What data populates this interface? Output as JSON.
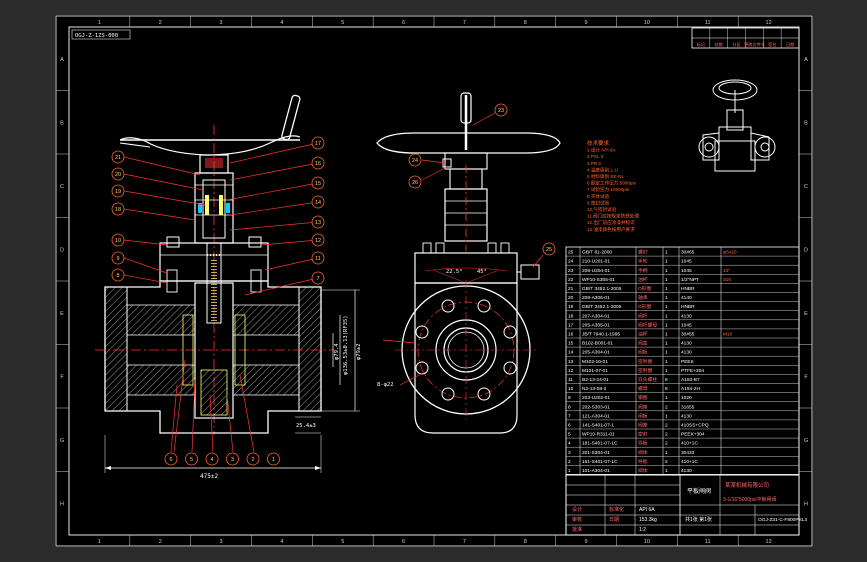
{
  "drawing_number_box": "OGJ-Z-1ZS-000",
  "frame": {
    "columns": [
      "1",
      "2",
      "3",
      "4",
      "5",
      "6",
      "7",
      "8",
      "9",
      "10",
      "11",
      "12"
    ],
    "rows": [
      "A",
      "B",
      "C",
      "D",
      "E",
      "F",
      "G",
      "H"
    ]
  },
  "dimensions": {
    "overall_length": "475±2",
    "bore": "φ79.4",
    "bolt_circle": "φ136.53±0.13(RF35)",
    "flange_od": "φ79±2",
    "raised_face": "25.4±3",
    "bolt_holes": "8-φ22",
    "angle_a": "22.5°",
    "angle_b": "45°",
    "extra": "25.5"
  },
  "left_balloons": [
    "21",
    "20",
    "19",
    "18",
    "10",
    "9",
    "8"
  ],
  "right_balloons": [
    "17",
    "16",
    "15",
    "14",
    "13",
    "12",
    "11",
    "7"
  ],
  "bottom_balloons": [
    "6",
    "5",
    "4",
    "3",
    "2",
    "1"
  ],
  "side_balloons": [
    "23",
    "24",
    "26",
    "25"
  ],
  "tech_notes": [
    "技术要求",
    "1.设计 API 6A",
    "2.PSL 3",
    "3.PR 2",
    "4.温度级别 L-U",
    "5.材料级别 EE-NL",
    "6.额定工作压力 5000psi",
    "7.试验压力 10000psi",
    "8.壳体试验",
    "9.密封试验",
    "10.气密封试验",
    "11.阀门应按规定防锈处理",
    "12.出厂前应涂漆并标识",
    "13.油漆颜色按用户要求"
  ],
  "bom": [
    {
      "no": "25",
      "code": "GB/T 81-2000",
      "name": "螺钉",
      "qty": "1",
      "mat": "30#65",
      "note": "φ5x10"
    },
    {
      "no": "24",
      "code": "210-U201-01",
      "name": "手轮",
      "qty": "1",
      "mat": "1045",
      "note": ""
    },
    {
      "no": "23",
      "code": "208-U204-01",
      "name": "手柄",
      "qty": "1",
      "mat": "1045",
      "note": "10\""
    },
    {
      "no": "22",
      "code": "WP10-S305-01",
      "name": "油杯",
      "qty": "1",
      "mat": "1/2\"NPT",
      "note": "316"
    },
    {
      "no": "21",
      "code": "GB/T 3452.1-2005",
      "name": "O形圈",
      "qty": "1",
      "mat": "HNBR",
      "note": ""
    },
    {
      "no": "20",
      "code": "208-A306-01",
      "name": "轴承",
      "qty": "1",
      "mat": "4140",
      "note": ""
    },
    {
      "no": "19",
      "code": "GB/T 3452.1-2005",
      "name": "O形圈",
      "qty": "1",
      "mat": "HNBR",
      "note": ""
    },
    {
      "no": "18",
      "code": "207-A304-01",
      "name": "阀杆",
      "qty": "1",
      "mat": "4130",
      "note": ""
    },
    {
      "no": "17",
      "code": "205-A305-01",
      "name": "阀杆螺母",
      "qty": "1",
      "mat": "1045",
      "note": ""
    },
    {
      "no": "16",
      "code": "JB/T 7940.1-1995",
      "name": "油杯",
      "qty": "1",
      "mat": "30#55",
      "note": "M10"
    },
    {
      "no": "15",
      "code": "B102-B001-01",
      "name": "阀盖",
      "qty": "1",
      "mat": "4130",
      "note": ""
    },
    {
      "no": "14",
      "code": "205-A304-01",
      "name": "阀板",
      "qty": "1",
      "mat": "4130",
      "note": ""
    },
    {
      "no": "13",
      "code": "M102-10-01",
      "name": "密封圈",
      "qty": "1",
      "mat": "PEEK",
      "note": ""
    },
    {
      "no": "12",
      "code": "M101-07-01",
      "name": "密封圈",
      "qty": "1",
      "mat": "PTFE+304",
      "note": ""
    },
    {
      "no": "11",
      "code": "B2-13-24-01",
      "name": "双头螺柱",
      "qty": "8",
      "mat": "A193-B7",
      "note": ""
    },
    {
      "no": "10",
      "code": "N2-13-08-2",
      "name": "螺母",
      "qty": "8",
      "mat": "A194-2H",
      "note": ""
    },
    {
      "no": "9",
      "code": "203-U202-01",
      "name": "钢圈",
      "qty": "1",
      "mat": "1020",
      "note": ""
    },
    {
      "no": "8",
      "code": "202-S303-01",
      "name": "阀座",
      "qty": "2",
      "mat": "31655",
      "note": ""
    },
    {
      "no": "7",
      "code": "121-A304-01",
      "name": "闸板",
      "qty": "1",
      "mat": "4130",
      "note": ""
    },
    {
      "no": "6",
      "code": "141-S401-07-1",
      "name": "阀座",
      "qty": "2",
      "mat": "410SS+CPQ",
      "note": ""
    },
    {
      "no": "5",
      "code": "WP10-R311-01",
      "name": "密封",
      "qty": "2",
      "mat": "PEEK+304",
      "note": ""
    },
    {
      "no": "4",
      "code": "181-S401-07-1C",
      "name": "导板",
      "qty": "2",
      "mat": "410+1C",
      "note": ""
    },
    {
      "no": "3",
      "code": "201-S304-01",
      "name": "阀体",
      "qty": "1",
      "mat": "30433",
      "note": ""
    },
    {
      "no": "2",
      "code": "161-S401-07-1C",
      "name": "导板",
      "qty": "2",
      "mat": "410+1C",
      "note": ""
    },
    {
      "no": "1",
      "code": "101-A304-01",
      "name": "阀体",
      "qty": "1",
      "mat": "4130",
      "note": ""
    }
  ],
  "title_block": {
    "company": "某某机械有限公司",
    "product": "平板闸阀",
    "description": "3-1/16\"5000psi平板闸阀",
    "drawing_no": "OGJ-Z31-C-F800PSL3",
    "sheet": "共1张 第1张",
    "scale": "1:2",
    "material": "API 6A",
    "mass": "153.3kg",
    "designer": "设计",
    "checker": "审核",
    "approver": "批准",
    "std": "标准化",
    "date": "日期"
  },
  "revision_table": {
    "headers": [
      "标记",
      "处数",
      "分区",
      "更改文件号",
      "签名",
      "日期"
    ]
  }
}
